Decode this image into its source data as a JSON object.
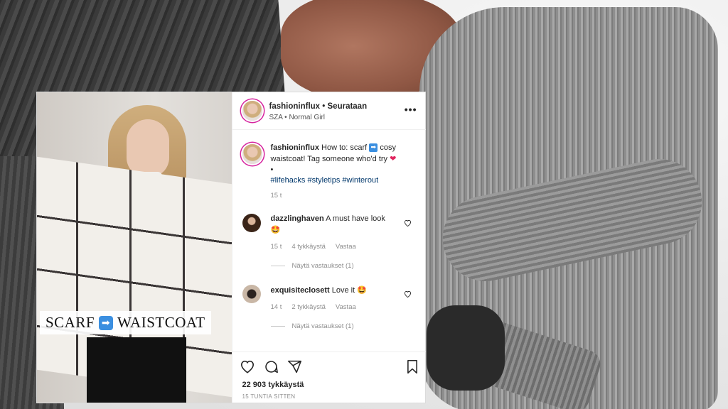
{
  "post": {
    "username": "fashioninflux",
    "follow_status": "Seurataan",
    "audio": "SZA • Normal Girl",
    "caption_text": "How to: scarf",
    "caption_arrow": "➡",
    "caption_text2": "cosy waistcoat! Tag someone who'd try",
    "caption_heart": "❤",
    "caption_bullet": "•",
    "hashtags": "#lifehacks #styletips #winterout",
    "time": "15 t",
    "image_caption_left": "SCARF",
    "image_caption_right": "WAISTCOAT"
  },
  "comments": [
    {
      "user": "dazzlinghaven",
      "text": "A must have look",
      "emoji": "🤩",
      "time": "15 t",
      "likes": "4 tykkäystä",
      "reply": "Vastaa",
      "view_replies": "Näytä vastaukset (1)"
    },
    {
      "user": "exquisiteclosett",
      "text": "Love it",
      "emoji": "🤩",
      "time": "14 t",
      "likes": "2 tykkäystä",
      "reply": "Vastaa",
      "view_replies": "Näytä vastaukset (1)"
    }
  ],
  "footer": {
    "likes": "22 903 tykkäystä",
    "posted_ago": "15 TUNTIA SITTEN"
  },
  "icons": {
    "more": "more-options-icon",
    "like": "heart-icon",
    "comment": "comment-icon",
    "share": "share-icon",
    "save": "bookmark-icon"
  },
  "colors": {
    "hashtag": "#00376b",
    "story_ring": "#d6249f",
    "muted": "#8e8e8e"
  }
}
